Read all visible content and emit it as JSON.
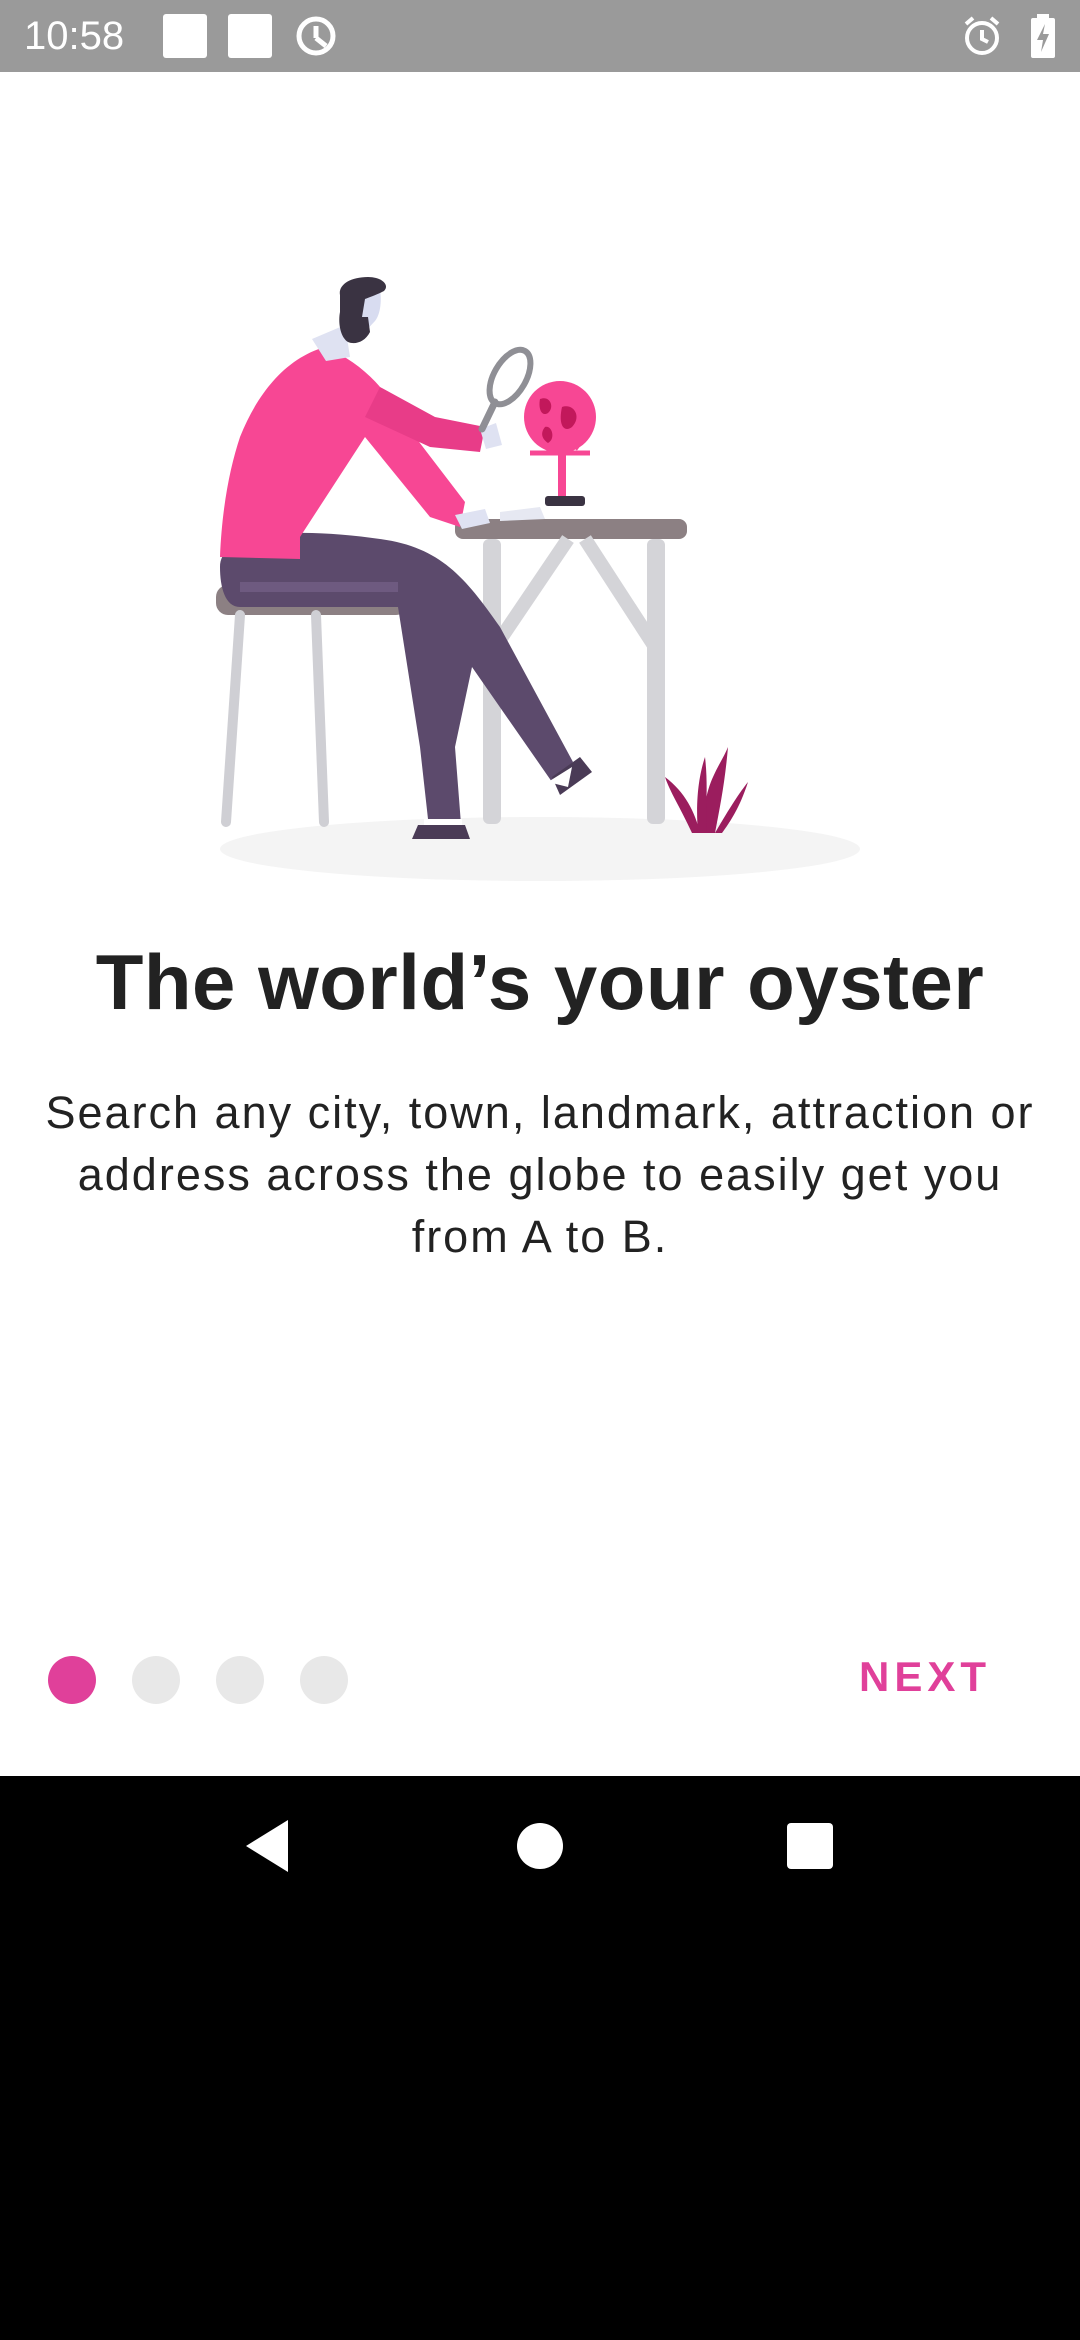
{
  "status_bar": {
    "time": "10:58",
    "icons": [
      "notification-square-icon",
      "notification-square-icon",
      "data-saver-icon",
      "alarm-icon",
      "battery-charging-icon"
    ]
  },
  "onboarding": {
    "title": "The world’s your oyster",
    "description": "Search any city, town, landmark, attraction or address across the globe to easily get you from A to B.",
    "page_indicator": {
      "total": 4,
      "current": 1
    },
    "next_label": "NEXT",
    "accent_color": "#e0409a"
  },
  "nav_bar": {
    "icons": [
      "back-icon",
      "home-icon",
      "recents-icon"
    ]
  }
}
